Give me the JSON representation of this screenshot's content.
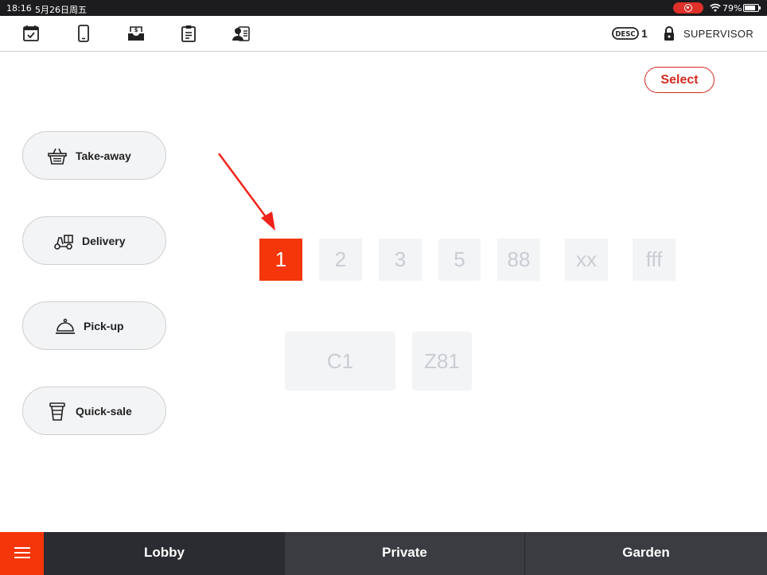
{
  "status_bar": {
    "time": "18:16",
    "date": "5月26日周五",
    "battery": "79%",
    "battery_level": 0.79
  },
  "toolbar": {
    "icons": [
      "calendar-check-icon",
      "tablet-icon",
      "cash-drawer-icon",
      "clipboard-icon",
      "user-card-icon"
    ],
    "desc_label": "DESC",
    "desc_count": "1",
    "user_role": "SUPERVISOR"
  },
  "select_label": "Select",
  "order_types": [
    {
      "label": "Take-away",
      "icon": "basket-icon"
    },
    {
      "label": "Delivery",
      "icon": "delivery-icon"
    },
    {
      "label": "Pick-up",
      "icon": "cloche-icon"
    },
    {
      "label": "Quick-sale",
      "icon": "cup-icon"
    }
  ],
  "tables": [
    {
      "label": "1",
      "active": true
    },
    {
      "label": "2"
    },
    {
      "label": "3"
    },
    {
      "label": "5"
    },
    {
      "label": "88"
    },
    {
      "label": "xx"
    },
    {
      "label": "fff"
    },
    {
      "label": "C1"
    },
    {
      "label": "Z81"
    }
  ],
  "areas": [
    {
      "label": "Lobby",
      "active": true
    },
    {
      "label": "Private"
    },
    {
      "label": "Garden"
    }
  ],
  "colors": {
    "accent": "#f4360a",
    "select_border": "#d42a1f",
    "bottom_bar": "#3a3c41"
  }
}
